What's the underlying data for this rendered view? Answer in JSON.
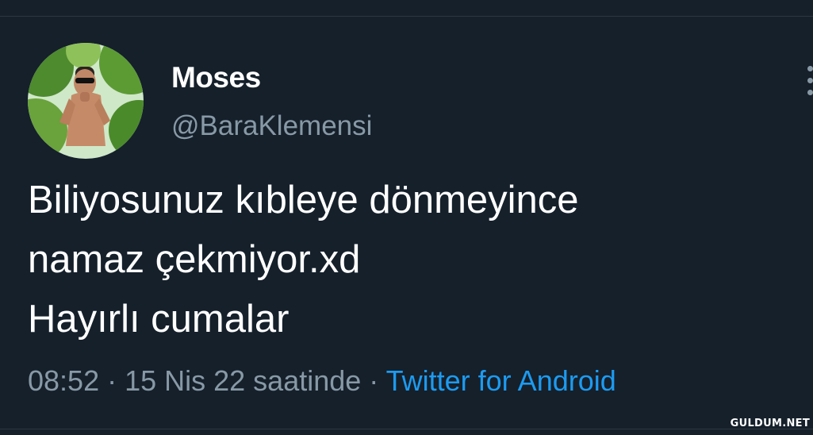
{
  "tweet": {
    "display_name": "Moses",
    "handle": "@BaraKlemensi",
    "text_lines": [
      "Biliyosunuz kıbleye dönmeyince",
      "namaz çekmiyor.xd",
      "Hayırlı cumalar"
    ],
    "time": "08:52",
    "separator": " · ",
    "date_text": "15 Nis 22 saatinde",
    "source": "Twitter for Android"
  },
  "icons": {
    "more": "more-options-icon",
    "avatar": "profile-avatar"
  },
  "watermark": "GULDUM.NET",
  "colors": {
    "background": "#15202b",
    "primary_text": "#ffffff",
    "secondary_text": "#8899a6",
    "link": "#1d9bf0",
    "divider": "#2b3640"
  }
}
